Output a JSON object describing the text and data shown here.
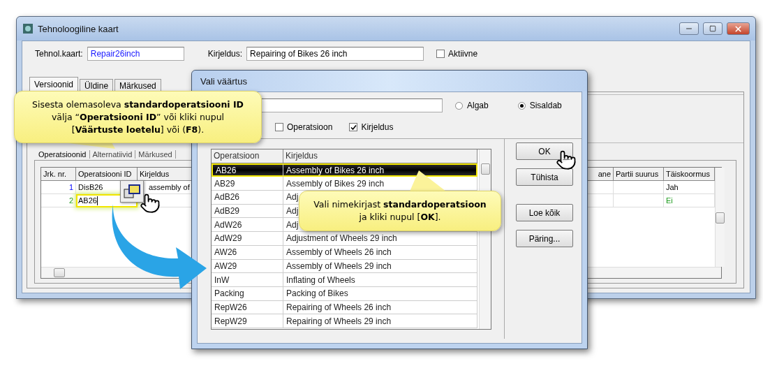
{
  "window": {
    "title": "Tehnoloogiline kaart"
  },
  "header_fields": [
    {
      "label": "Tehnol.kaart:",
      "value": "Repair26inch"
    },
    {
      "label": "Kirjeldus:",
      "value": "Repairing of Bikes 26 inch"
    }
  ],
  "active_checkbox": {
    "label": "Aktiivne",
    "checked": false
  },
  "tabs": [
    {
      "label": "Versioonid",
      "selected": true
    },
    {
      "label": "Üldine",
      "selected": false
    },
    {
      "label": "Märkused",
      "selected": false
    }
  ],
  "inner_tabs": [
    {
      "label": "Operatsioonid",
      "selected": true
    },
    {
      "label": "Alternatiivid",
      "selected": false
    },
    {
      "label": "Märkused",
      "selected": false
    }
  ],
  "grid": {
    "columns": [
      "Jrk. nr.",
      "Operatsiooni ID",
      "Kirjeldus",
      "ane",
      "Partii suurus",
      "Täiskoormus"
    ],
    "rows": [
      {
        "new": false,
        "cells": [
          {
            "text": "1"
          },
          {
            "text": "DisB26"
          },
          {
            "text": "assembly of"
          },
          {},
          {},
          {
            "text": "Jah"
          }
        ]
      },
      {
        "new": true,
        "cells": [
          {
            "text": "2"
          },
          {
            "text": "AB26",
            "highlighted": true
          },
          {},
          {},
          {},
          {
            "text": "Ei"
          }
        ]
      }
    ]
  },
  "dialog": {
    "title": "Vali väärtus",
    "match_mode": [
      {
        "label": "Algab",
        "selected": false
      },
      {
        "label": "Sisaldab",
        "selected": true
      }
    ],
    "search_in": [
      {
        "label": "Operatsioon",
        "checked": false
      },
      {
        "label": "Kirjeldus",
        "checked": true
      }
    ],
    "list": {
      "columns": [
        "Operatsioon",
        "Kirjeldus"
      ],
      "rows": [
        {
          "id": "AB26",
          "description": "Assembly of Bikes 26 inch",
          "selected": true
        },
        {
          "id": "AB29",
          "description": "Assembly of Bikes 29 inch",
          "selected": false
        },
        {
          "id": "AdB26",
          "description": "Adj",
          "selected": false
        },
        {
          "id": "AdB29",
          "description": "Adj",
          "selected": false
        },
        {
          "id": "AdW26",
          "description": "Adj",
          "selected": false
        },
        {
          "id": "AdW29",
          "description": "Adjustment of Wheels 29 inch",
          "selected": false
        },
        {
          "id": "AW26",
          "description": "Assembly of Wheels 26 inch",
          "selected": false
        },
        {
          "id": "AW29",
          "description": "Assembly of Wheels 29 inch",
          "selected": false
        },
        {
          "id": "InW",
          "description": "Inflating of Wheels",
          "selected": false
        },
        {
          "id": "Packing",
          "description": "Packing of Bikes",
          "selected": false
        },
        {
          "id": "RepW26",
          "description": "Repairing of Wheels 26 inch",
          "selected": false
        },
        {
          "id": "RepW29",
          "description": "Repairing of Wheels 29 inch",
          "selected": false
        }
      ]
    },
    "buttons": [
      "OK",
      "Tühista",
      "Loe kõik",
      "Päring..."
    ]
  },
  "callouts": [
    {
      "lines": [
        "Sisesta olemasoleva **standardoperatsiooni ID**",
        "välja “**Operatsiooni ID**” või kliki nupul",
        "[**Väärtuste loetelu**] või (**F8**)."
      ]
    },
    {
      "lines": [
        "Vali nimekirjast **standardoperatsioon**",
        "ja kliki nupul [**OK**]."
      ]
    }
  ]
}
